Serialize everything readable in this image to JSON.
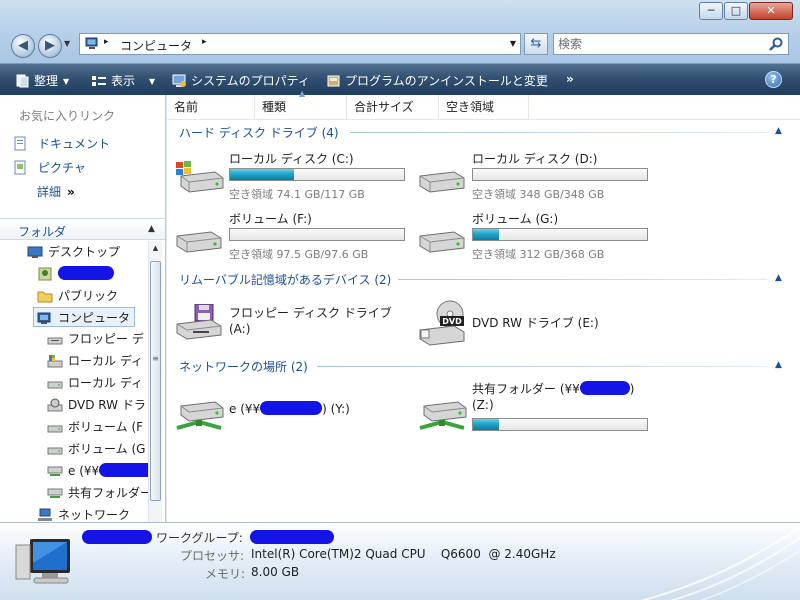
{
  "window": {
    "minimize_glyph": "─",
    "maximize_glyph": "□",
    "close_glyph": "✕"
  },
  "address": {
    "path": "コンピュータ",
    "separator": "▸"
  },
  "search": {
    "placeholder": "検索"
  },
  "toolbar": {
    "organize": "整理",
    "views": "表示",
    "system_properties": "システムのプロパティ",
    "uninstall": "プログラムのアンインストールと変更",
    "more": "»",
    "help": "?"
  },
  "favorites": {
    "header": "お気に入りリンク",
    "items": [
      "ドキュメント",
      "ピクチャ"
    ],
    "more_label": "詳細",
    "more_glyph": "»"
  },
  "folders": {
    "header": "フォルダ",
    "tree": [
      "デスクトップ",
      "",
      "パブリック",
      "コンピュータ",
      "フロッピー デ",
      "ローカル ディ",
      "ローカル ディ",
      "DVD RW ドラ",
      "ボリューム (F",
      "ボリューム (G",
      "e (¥¥",
      "共有フォルダー",
      "ネットワーク"
    ]
  },
  "columns": [
    "名前",
    "種類",
    "合計サイズ",
    "空き領域"
  ],
  "groups": {
    "hdd": {
      "title": "ハード ディスク ドライブ (4)"
    },
    "removable": {
      "title": "リムーバブル記憶域があるデバイス (2)"
    },
    "network": {
      "title": "ネットワークの場所 (2)"
    }
  },
  "drives": {
    "c": {
      "label": "ローカル ディスク (C:)",
      "free_text": "空き領域 74.1 GB/117 GB",
      "used_fraction": 0.37
    },
    "d": {
      "label": "ローカル ディスク (D:)",
      "free_text": "空き領域 348 GB/348 GB",
      "used_fraction": 0.0
    },
    "f": {
      "label": "ボリューム (F:)",
      "free_text": "空き領域 97.5 GB/97.6 GB",
      "used_fraction": 0.0
    },
    "g": {
      "label": "ボリューム (G:)",
      "free_text": "空き領域 312 GB/368 GB",
      "used_fraction": 0.15
    }
  },
  "removable": {
    "floppy": {
      "label": "フロッピー ディスク ドライブ",
      "label2": "(A:)"
    },
    "dvd": {
      "label": "DVD RW ドライブ (E:)",
      "badge": "DVD"
    }
  },
  "network": {
    "y": {
      "prefix": "e (¥¥",
      "suffix": ") (Y:)"
    },
    "z": {
      "prefix": "共有フォルダー (¥¥",
      "suffix": ")",
      "label2": "(Z:)",
      "used_fraction": 0.15
    }
  },
  "details": {
    "workgroup_label": "ワークグループ:",
    "processor_label": "プロセッサ:",
    "processor_value": "Intel(R) Core(TM)2 Quad CPU    Q6600  @ 2.40GHz",
    "memory_label": "メモリ:",
    "memory_value": "8.00 GB"
  },
  "colors": {
    "accent": "#1c4f99",
    "toolbar": "#2e4d6f",
    "bar_fill": "#1fa4c9",
    "redaction": "#1414e6"
  }
}
